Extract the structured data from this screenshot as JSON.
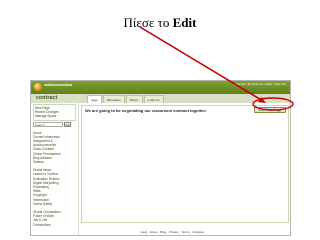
{
  "slide": {
    "title_prefix": "Πίεσε το ",
    "title_bold": "Edit"
  },
  "header": {
    "site_name": "onlineconnections",
    "user_links": "pltoman | My Account | Help | Sign Out"
  },
  "wiki": {
    "title": "contract",
    "tabs": [
      "page",
      "discussion",
      "history",
      "notify me"
    ],
    "meta": "contract"
  },
  "sidebar": {
    "user_links": [
      "New Page",
      "Recent Changes",
      "Manage Space"
    ],
    "search_value": "Search",
    "search_button": "Go",
    "nav_group_1": [
      "Home",
      "Course Information",
      "Assignment &",
      "Announcements",
      "Class Contract",
      "Online Permissions",
      "Blog Address",
      "Sidebar"
    ],
    "nav_group_2": [
      "Global News",
      "Learner's Toolbox",
      "Evaluation Rubrics",
      "Digital Storytelling",
      "Podcasting",
      "Wikis",
      "Copyright",
      "Information",
      "Online Safety"
    ],
    "nav_group_3": [
      "Global Connections",
      "Future of Work",
      "Job & Life",
      "Connections"
    ]
  },
  "content": {
    "text": "We are going to be negotiating our classroom contract together.",
    "edit_button": "Edit This Page"
  },
  "footer": {
    "text": "Help · About · Blog · Privacy · Terms · Upgrade"
  },
  "colors": {
    "brand_green": "#6b8b22",
    "callout_red": "#cc0000"
  }
}
